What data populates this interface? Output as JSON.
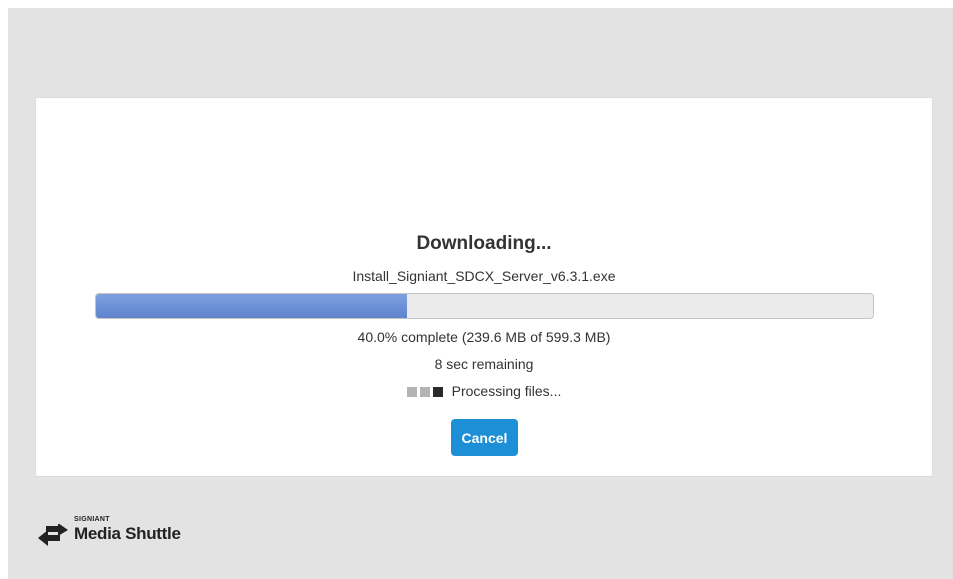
{
  "download": {
    "title": "Downloading...",
    "filename": "Install_Signiant_SDCX_Server_v6.3.1.exe",
    "progress_percent": 40.0,
    "status_text": "40.0% complete (239.6 MB of 599.3 MB)",
    "remaining_text": "8 sec remaining",
    "processing_text": "Processing files...",
    "cancel_label": "Cancel"
  },
  "logo": {
    "brand": "SIGNIANT",
    "product": "Media Shuttle"
  },
  "colors": {
    "accent": "#1c8fd6",
    "progress": "#6b8fd4",
    "background": "#e3e3e3"
  }
}
